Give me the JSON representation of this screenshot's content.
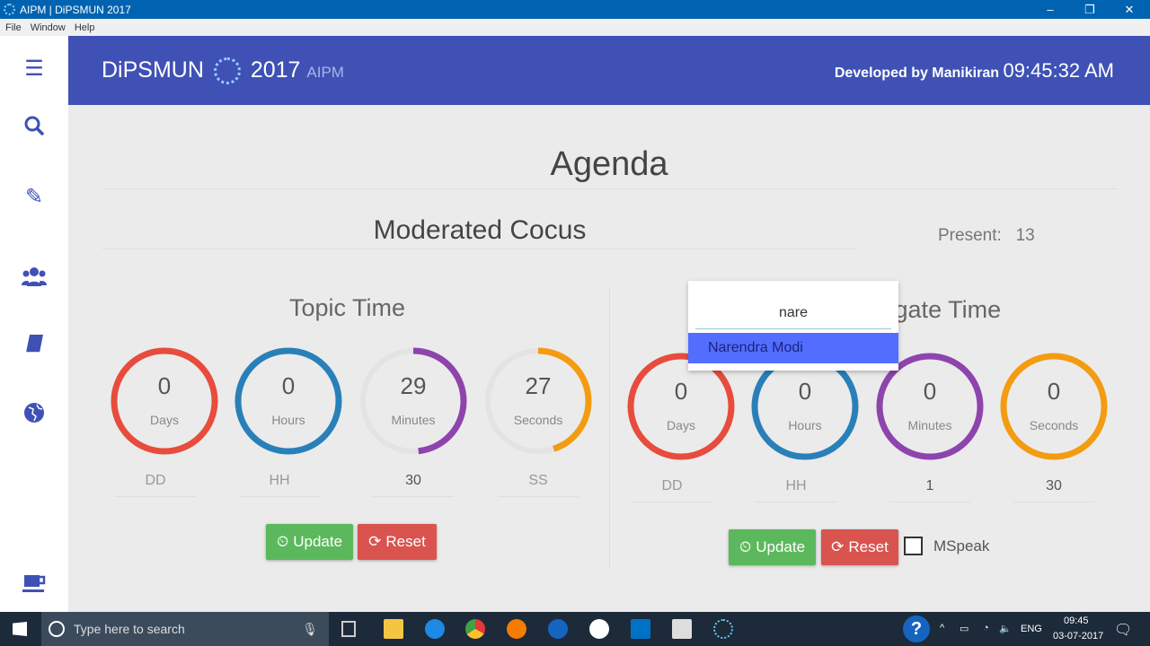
{
  "window": {
    "title": "AIPM | DiPSMUN 2017",
    "controls": [
      "–",
      "❐",
      "✕"
    ]
  },
  "menu": [
    "File",
    "Window",
    "Help"
  ],
  "sidebar": {
    "icons": [
      "menu-icon",
      "search-icon",
      "pencil-icon",
      "users-icon",
      "book-icon",
      "globe-icon",
      "coffee-icon"
    ]
  },
  "header": {
    "brand": "DiPSMUN",
    "year": "2017",
    "org": "AIPM",
    "developed_by": "Developed by Manikiran",
    "clock": "09:45:32 AM"
  },
  "agenda": "Agenda",
  "mode": "Moderated Cocus",
  "present": {
    "label": "Present:",
    "value": "13"
  },
  "topic": {
    "title": "Topic Time",
    "rings": [
      {
        "value": "0",
        "label": "Days",
        "color": "#e74c3c",
        "fraction": 1
      },
      {
        "value": "0",
        "label": "Hours",
        "color": "#2980b9",
        "fraction": 1
      },
      {
        "value": "29",
        "label": "Minutes",
        "color": "#8e44ad",
        "fraction": 0.483
      },
      {
        "value": "27",
        "label": "Seconds",
        "color": "#f39c12",
        "fraction": 0.45
      }
    ],
    "fields": [
      "DD",
      "HH",
      "30",
      "SS"
    ],
    "update": "Update",
    "reset": "Reset"
  },
  "delegate": {
    "title": "Delegate Time",
    "rings": [
      {
        "value": "0",
        "label": "Days",
        "color": "#e74c3c",
        "fraction": 1
      },
      {
        "value": "0",
        "label": "Hours",
        "color": "#2980b9",
        "fraction": 1
      },
      {
        "value": "0",
        "label": "Minutes",
        "color": "#8e44ad",
        "fraction": 1
      },
      {
        "value": "0",
        "label": "Seconds",
        "color": "#f39c12",
        "fraction": 1
      }
    ],
    "fields": [
      "DD",
      "HH",
      "1",
      "30"
    ],
    "update": "Update",
    "reset": "Reset",
    "mspeak": "MSpeak"
  },
  "autocomplete": {
    "value": "nare",
    "option": "Narendra Modi"
  },
  "taskbar": {
    "search_placeholder": "Type here to search",
    "lang": "ENG",
    "time": "09:45",
    "date": "03-07-2017"
  }
}
